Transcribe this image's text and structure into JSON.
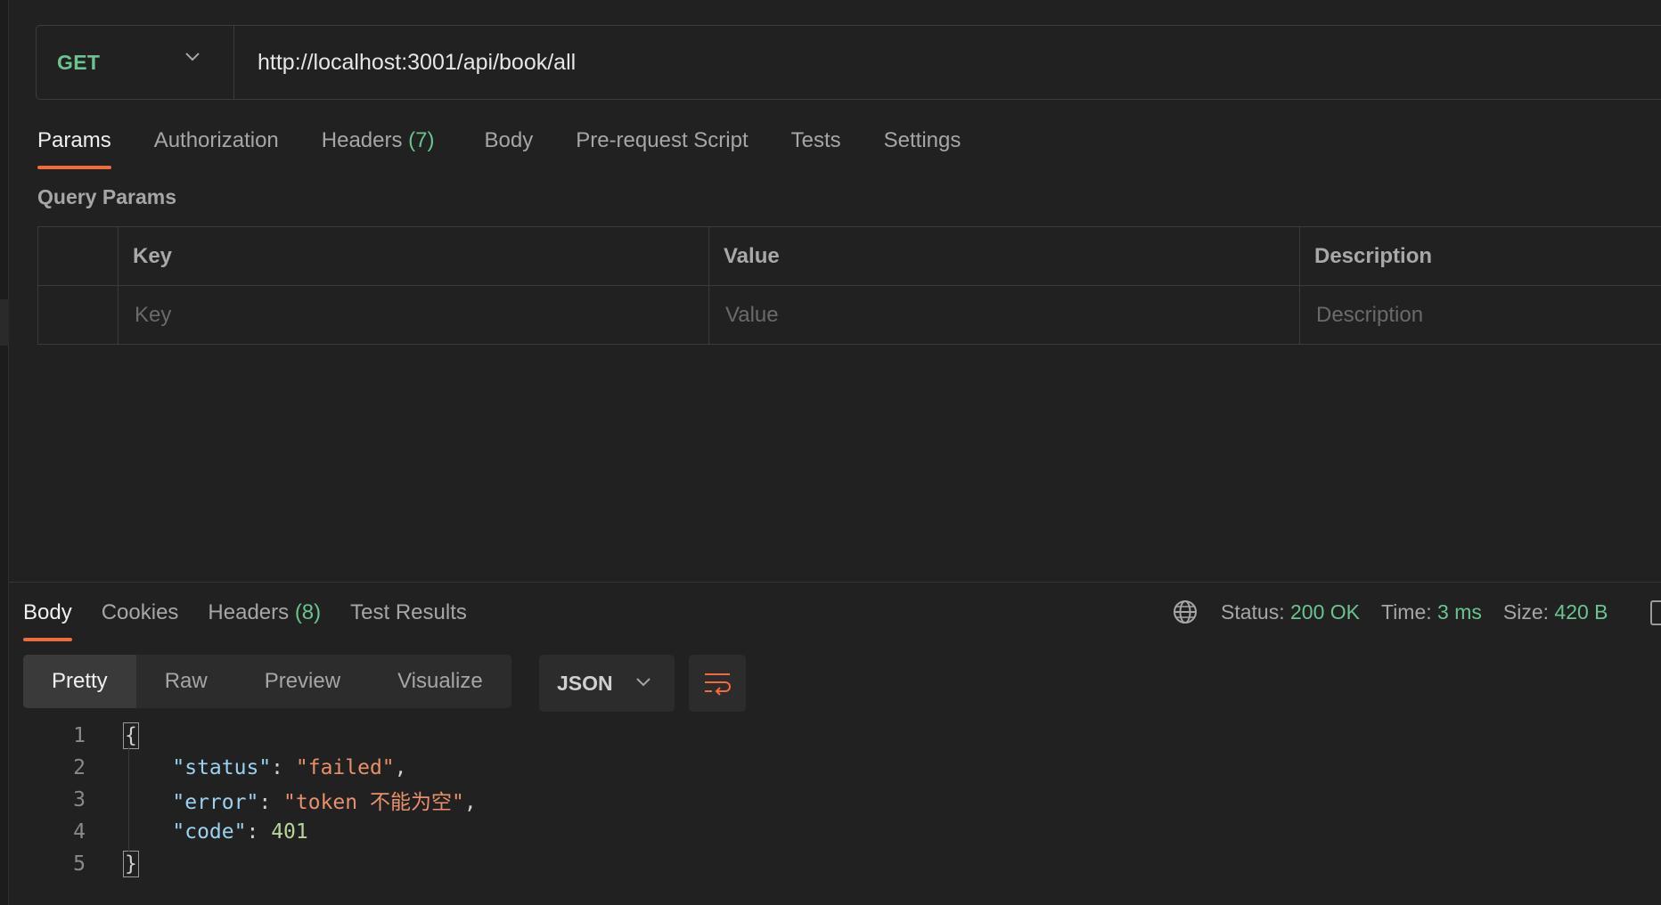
{
  "request": {
    "method": "GET",
    "url": "http://localhost:3001/api/book/all"
  },
  "request_tabs": [
    {
      "label": "Params",
      "count": "",
      "active": true
    },
    {
      "label": "Authorization",
      "count": ""
    },
    {
      "label": "Headers",
      "count": "(7)"
    },
    {
      "label": "Body",
      "count": ""
    },
    {
      "label": "Pre-request Script",
      "count": ""
    },
    {
      "label": "Tests",
      "count": ""
    },
    {
      "label": "Settings",
      "count": ""
    }
  ],
  "query_params": {
    "title": "Query Params",
    "columns": [
      "Key",
      "Value",
      "Description"
    ],
    "placeholders": {
      "key": "Key",
      "value": "Value",
      "description": "Description"
    }
  },
  "response_tabs": [
    {
      "label": "Body",
      "count": "",
      "active": true
    },
    {
      "label": "Cookies",
      "count": ""
    },
    {
      "label": "Headers",
      "count": "(8)"
    },
    {
      "label": "Test Results",
      "count": ""
    }
  ],
  "response_meta": {
    "status_label": "Status:",
    "status_value": "200 OK",
    "time_label": "Time:",
    "time_value": "3 ms",
    "size_label": "Size:",
    "size_value": "420 B"
  },
  "view_modes": [
    "Pretty",
    "Raw",
    "Preview",
    "Visualize"
  ],
  "format": "JSON",
  "code": {
    "line_numbers": [
      "1",
      "2",
      "3",
      "4",
      "5"
    ],
    "open_brace": "{",
    "close_brace": "}",
    "fields": [
      {
        "key": "\"status\"",
        "value": "\"failed\"",
        "value_type": "string",
        "comma": ","
      },
      {
        "key": "\"error\"",
        "value": "\"token 不能为空\"",
        "value_type": "string",
        "comma": ","
      },
      {
        "key": "\"code\"",
        "value": "401",
        "value_type": "number",
        "comma": ""
      }
    ]
  },
  "icons": {
    "method_dropdown": "chevron-down-icon",
    "format_dropdown": "chevron-down-icon",
    "network": "globe-icon",
    "wrap": "wrap-lines-icon"
  },
  "colors": {
    "accent": "#f26b3a",
    "success": "#6bc48f",
    "json_key": "#9cd2f0",
    "json_string": "#e8906a",
    "json_number": "#b7d59a"
  }
}
